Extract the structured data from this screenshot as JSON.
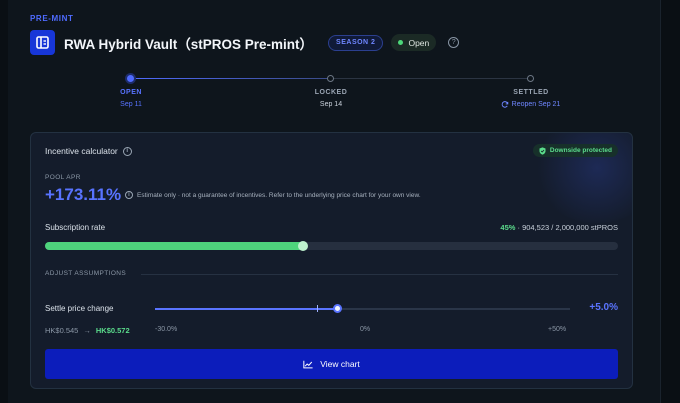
{
  "header": {
    "eyebrow": "PRE-MINT",
    "title": "RWA Hybrid Vault（stPROS Pre-mint）",
    "season_badge": "SEASON 2",
    "status": "Open",
    "help_icon": "question-circle-icon",
    "logo_icon": "vault-logo-icon"
  },
  "timeline": {
    "progress_fraction": 0.0,
    "steps": [
      {
        "label": "OPEN",
        "date": "Sep 11",
        "state": "active"
      },
      {
        "label": "LOCKED",
        "date": "Sep 14",
        "state": "upcoming"
      },
      {
        "label": "SETTLED",
        "date": "Reopen Sep 21",
        "state": "upcoming",
        "icon": "refresh-icon"
      }
    ]
  },
  "calculator": {
    "title": "Incentive calculator",
    "badge": "Downside protected",
    "badge_icon": "shield-check-icon",
    "pool_apr_label": "POOL APR",
    "pool_apr_value": "+173.11%",
    "apr_note": "Estimate only · not a guarantee of incentives. Refer to the underlying price chart for your own view.",
    "subscription": {
      "label": "Subscription rate",
      "percent_text": "45%",
      "detail": " · 904,523 / 2,000,000 stPROS",
      "fill_fraction": 0.45
    },
    "assumptions_label": "ADJUST ASSUMPTIONS",
    "settle": {
      "label": "Settle price change",
      "value": "+5.0%",
      "min": -30,
      "max": 50,
      "current": 5,
      "range_min_label": "-30.0%",
      "range_mid_label": "0%",
      "range_max_label": "+50%",
      "price_old": "HK$0.545",
      "price_new": "HK$0.572",
      "arrow": "→"
    },
    "chart_button": "View chart",
    "chart_button_icon": "line-chart-icon"
  },
  "colors": {
    "accent_blue": "#5873ff",
    "accent_green": "#4ed37c",
    "button_blue": "#0c1dbb"
  }
}
